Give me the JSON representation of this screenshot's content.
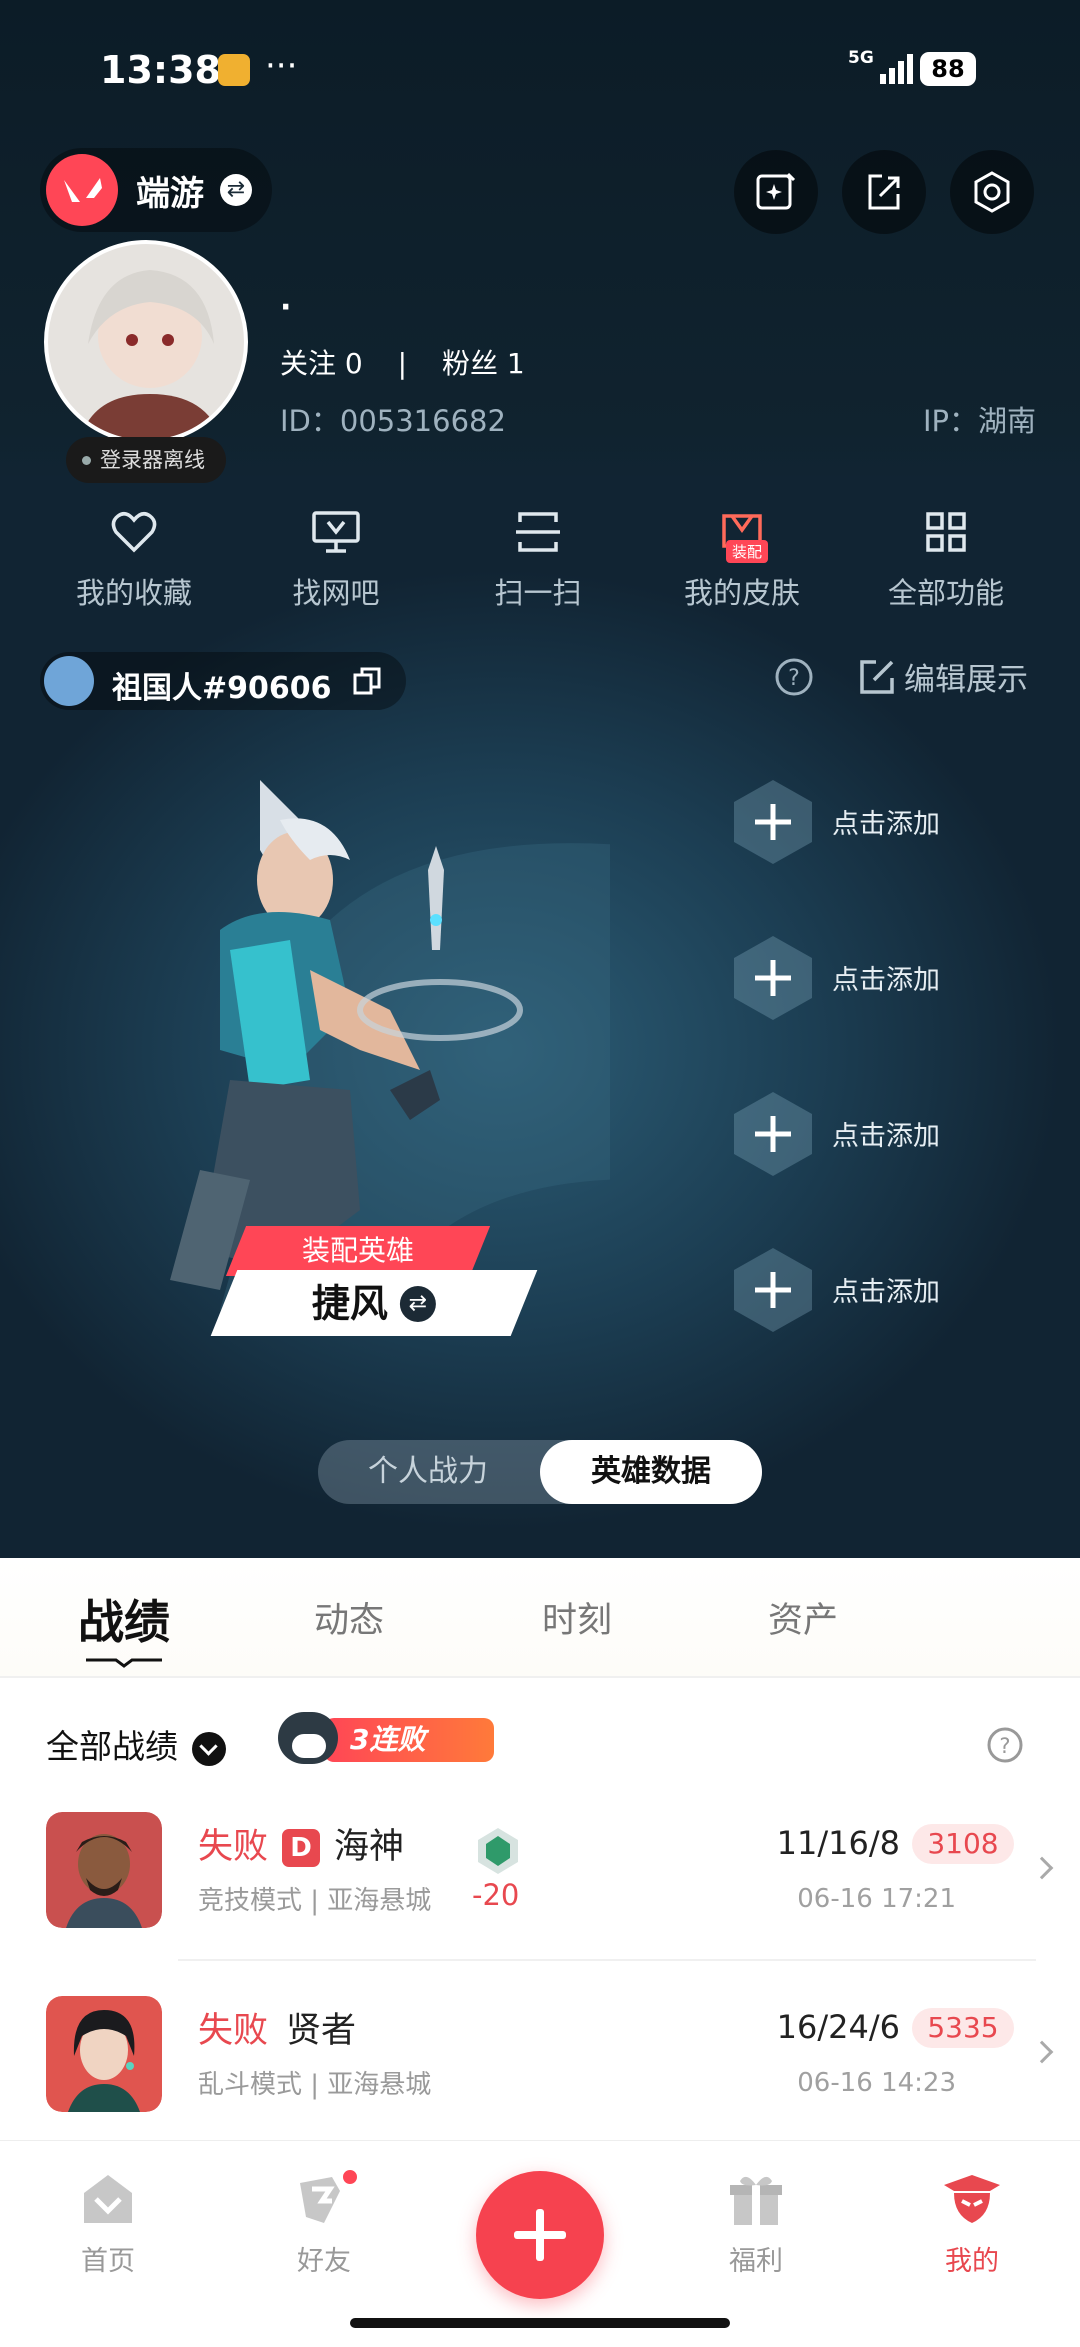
{
  "status": {
    "time": "13:38",
    "network": "5G",
    "battery": "88"
  },
  "header": {
    "game_name": "端游"
  },
  "profile": {
    "nickname": "·",
    "following_label": "关注",
    "following_count": "0",
    "followers_label": "粉丝",
    "followers_count": "1",
    "id_text": "ID：005316682",
    "ip_text": "IP：湖南",
    "offline_status": "登录器离线"
  },
  "quick_actions": [
    {
      "label": "我的收藏",
      "icon": "heart-icon"
    },
    {
      "label": "找网吧",
      "icon": "monitor-icon"
    },
    {
      "label": "扫一扫",
      "icon": "scan-icon"
    },
    {
      "label": "我的皮肤",
      "icon": "skin-icon",
      "badge": "装配"
    },
    {
      "label": "全部功能",
      "icon": "grid-icon"
    }
  ],
  "riot_id": "祖国人#90606",
  "edit_label": "编辑展示",
  "hero": {
    "tag": "装配英雄",
    "name": "捷风"
  },
  "slots": [
    {
      "label": "点击添加"
    },
    {
      "label": "点击添加"
    },
    {
      "label": "点击添加"
    },
    {
      "label": "点击添加"
    }
  ],
  "toggle": {
    "left": "个人战力",
    "right": "英雄数据"
  },
  "tabs": [
    "战绩",
    "动态",
    "时刻",
    "资产"
  ],
  "filter": {
    "label": "全部战绩",
    "streak": "3连败"
  },
  "matches": [
    {
      "result": "失败",
      "rank_badge": "D",
      "hero": "海神",
      "mode": "竞技模式 | 亚海悬城",
      "delta": "-20",
      "kda": "11/16/8",
      "score": "3108",
      "date": "06-16 17:21",
      "avatar_color": "#c9504f"
    },
    {
      "result": "失败",
      "rank_badge": "",
      "hero": "贤者",
      "mode": "乱斗模式 | 亚海悬城",
      "delta": "",
      "kda": "16/24/6",
      "score": "5335",
      "date": "06-16 14:23",
      "avatar_color": "#e0554f"
    }
  ],
  "nav": [
    {
      "label": "首页",
      "icon": "home-icon"
    },
    {
      "label": "好友",
      "icon": "friends-icon"
    },
    {
      "label": "福利",
      "icon": "gift-icon"
    },
    {
      "label": "我的",
      "icon": "profile-icon"
    }
  ],
  "colors": {
    "accent": "#ff4656",
    "loss": "#e8484f",
    "bg": "#112433"
  }
}
